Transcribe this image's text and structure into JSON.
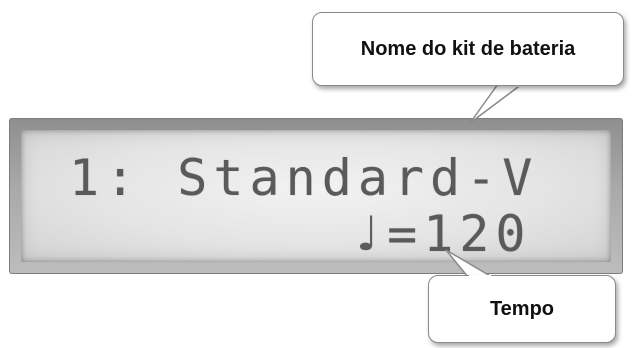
{
  "lcd": {
    "line1": "1: Standard-V",
    "line2": "♩=120"
  },
  "callouts": {
    "kit_name": "Nome do kit de bateria",
    "tempo": "Tempo"
  },
  "colors": {
    "lcd_text": "#5a5a5a",
    "lcd_background": "#e4e4e4",
    "bezel": "#a9a9a9",
    "callout_border": "#8a8a8a"
  }
}
